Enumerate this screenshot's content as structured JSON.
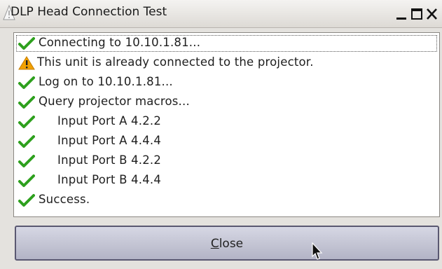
{
  "window": {
    "title": "DLP Head Connection Test",
    "icon": "warning-triangle-icon"
  },
  "window_controls": {
    "minimize_icon": "minimize-icon",
    "maximize_icon": "maximize-icon",
    "close_icon": "close-icon"
  },
  "log": [
    {
      "status": "success",
      "icon": "checkmark-icon",
      "text": "Connecting to 10.10.1.81..."
    },
    {
      "status": "warning",
      "icon": "warning-icon",
      "text": "This unit is already connected to the projector."
    },
    {
      "status": "success",
      "icon": "checkmark-icon",
      "text": "Log on to 10.10.1.81..."
    },
    {
      "status": "success",
      "icon": "checkmark-icon",
      "text": "Query projector macros..."
    },
    {
      "status": "success",
      "icon": "checkmark-icon",
      "text": "Input Port A 4.2.2"
    },
    {
      "status": "success",
      "icon": "checkmark-icon",
      "text": "Input Port A 4.4.4"
    },
    {
      "status": "success",
      "icon": "checkmark-icon",
      "text": "Input Port B 4.2.2"
    },
    {
      "status": "success",
      "icon": "checkmark-icon",
      "text": "Input Port B 4.4.4"
    },
    {
      "status": "success",
      "icon": "checkmark-icon",
      "text": "Success."
    }
  ],
  "buttons": {
    "close_mnemonic": "C",
    "close_rest": "lose"
  },
  "colors": {
    "success": "#2ea01e",
    "warning": "#f2a100",
    "button": "#c3c4d3"
  }
}
